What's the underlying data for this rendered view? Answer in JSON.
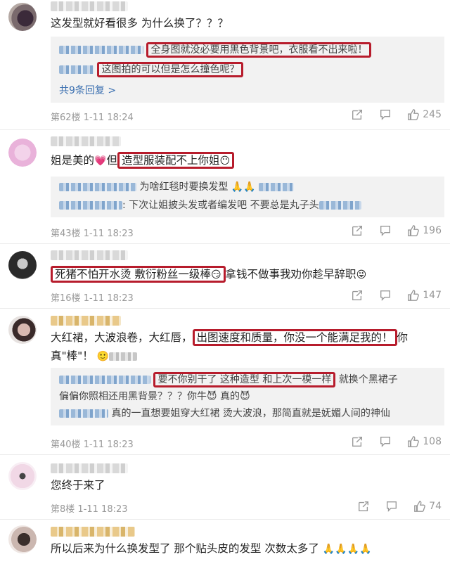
{
  "comments": [
    {
      "text": "这发型就好看很多 为什么换了？？？",
      "replies": [
        {
          "text": "全身图就没必要用黑色背景吧，衣服看不出来啦！"
        },
        {
          "text": "这图拍的可以但是怎么撞色呢？"
        }
      ],
      "more": "共9条回复 >",
      "floor": "第62楼",
      "date": "1-11 18:24",
      "likes": "245"
    },
    {
      "text_a": "姐是美的",
      "text_b": "但",
      "text_hl": "造型服装配不上你姐",
      "replies": [
        {
          "text": "为啥红毯时要换发型"
        },
        {
          "text": ": 下次让姐披头发或者编发吧 不要总是丸子头"
        }
      ],
      "floor": "第43楼",
      "date": "1-11 18:23",
      "likes": "196"
    },
    {
      "text_hl": "死猪不怕开水烫  敷衍粉丝一级棒",
      "text_b": "拿钱不做事我劝你趁早辞职",
      "floor": "第16楼",
      "date": "1-11 18:23",
      "likes": "147"
    },
    {
      "text_a": "大红裙，大波浪卷，大红唇，",
      "text_hl": "出图速度和质量，你没一个能满足我的！",
      "text_b": "你真\"棒\"！",
      "reply1_hl": "要不你别干了    这种造型  和上次一模一样",
      "reply1_b": "就换个黑裙子",
      "reply2": "偏偏你照相还用黑背景？？？你牛",
      "reply2_b": "真的",
      "reply3": "真的一直想要姐穿大红裙 烫大波浪，那简直就是妩媚人间的神仙",
      "floor": "第40楼",
      "date": "1-11 18:23",
      "likes": "108"
    },
    {
      "text": "您终于来了",
      "floor": "第8楼",
      "date": "1-11 18:23",
      "likes": "74"
    },
    {
      "text": "所以后来为什么换发型了  那个贴头皮的发型   次数太多了"
    }
  ],
  "icons": {
    "share": "share-icon",
    "comment": "comment-icon",
    "like": "thumb-up-icon"
  },
  "colors": {
    "highlight": "#b71c2c",
    "link": "#3a6fb0",
    "reply_bg": "#f2f2f2"
  }
}
